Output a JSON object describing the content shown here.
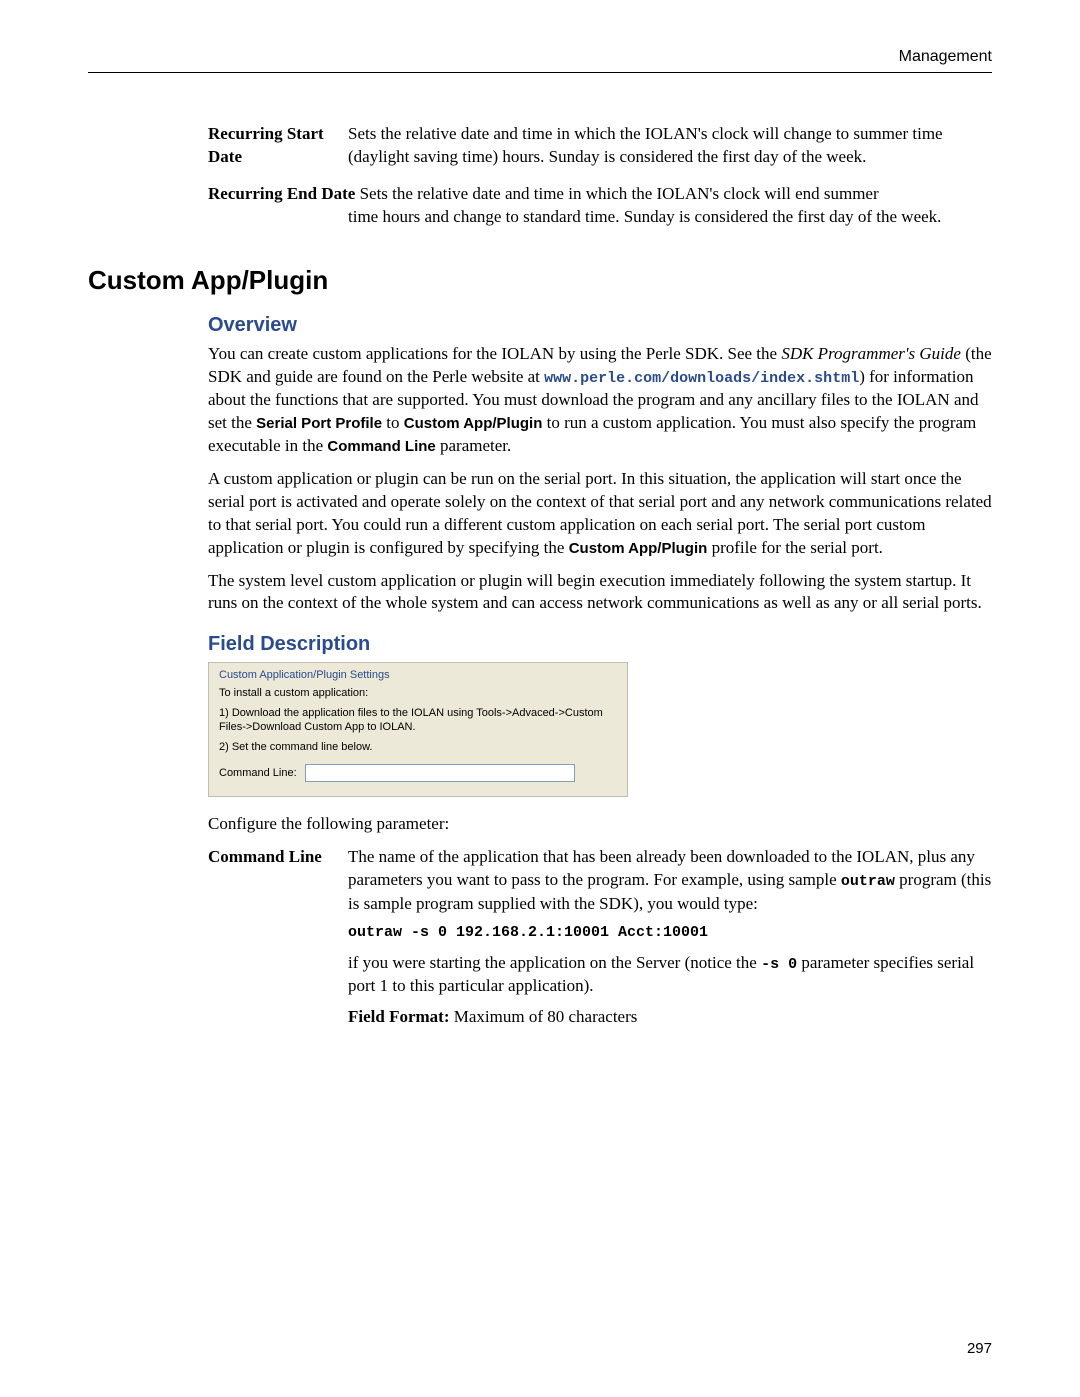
{
  "header": {
    "section": "Management"
  },
  "defs": {
    "recurring_start": {
      "term": "Recurring Start Date",
      "desc": "Sets the relative date and time in which the IOLAN's clock will change to summer time (daylight saving time) hours. Sunday is considered the first day of the week."
    },
    "recurring_end": {
      "term": "Recurring End Date",
      "desc_first": "Sets the relative date and time in which the IOLAN's clock will end summer",
      "desc_rest": "time hours and change to standard time. Sunday is considered the first day of the week."
    }
  },
  "section_title": "Custom App/Plugin",
  "overview": {
    "heading": "Overview",
    "p1_a": "You can create custom applications for the IOLAN by using the Perle SDK. See the ",
    "p1_i": "SDK Programmer's Guide",
    "p1_b": " (the SDK and guide are found on the Perle website at ",
    "p1_link": "www.perle.com/downloads/index.shtml",
    "p1_c": ") for information about the functions that are supported. You must download the program and any ancillary files to the IOLAN and set the ",
    "p1_bold1": "Serial Port Profile",
    "p1_d": " to ",
    "p1_bold2": "Custom App/Plugin",
    "p1_e": " to run a custom application. You must also specify the program executable in the ",
    "p1_bold3": "Command Line",
    "p1_f": " parameter.",
    "p2_a": "A custom application or plugin can be run on the serial port. In this situation, the application will start once the serial port is activated and operate solely on the context of that serial port and any network communications related to that serial port. You could run a different custom application on each serial port. The serial port custom application or plugin is configured by specifying the ",
    "p2_bold": "Custom App/Plugin",
    "p2_b": " profile for the serial port.",
    "p3": "The system level custom application or plugin will begin execution immediately following the system startup. It runs on the context of the whole system and can access network communications as well as any or all serial ports."
  },
  "field_desc": {
    "heading": "Field Description",
    "panel": {
      "title": "Custom Application/Plugin Settings",
      "line1": "To install a custom application:",
      "line2": "1) Download the application files to the IOLAN using Tools->Advaced->Custom Files->Download Custom App to IOLAN.",
      "line3": "2) Set the command line below.",
      "cmd_label": "Command Line:",
      "cmd_value": ""
    },
    "configure_line": "Configure the following parameter:",
    "param": {
      "term": "Command Line",
      "d1_a": "The name of the application that has been already been downloaded to the IOLAN, plus any parameters you want to pass to the program. For example, using sample ",
      "d1_mono": "outraw",
      "d1_b": " program (this is sample program supplied with the SDK), you would type:",
      "example": "outraw -s 0 192.168.2.1:10001 Acct:10001",
      "d2_a": "if you were starting the application on the Server (notice the ",
      "d2_mono": "-s 0",
      "d2_b": " parameter specifies serial port 1 to this particular application).",
      "d3_bold": "Field Format:",
      "d3_rest": " Maximum of 80 characters"
    }
  },
  "page_number": "297"
}
